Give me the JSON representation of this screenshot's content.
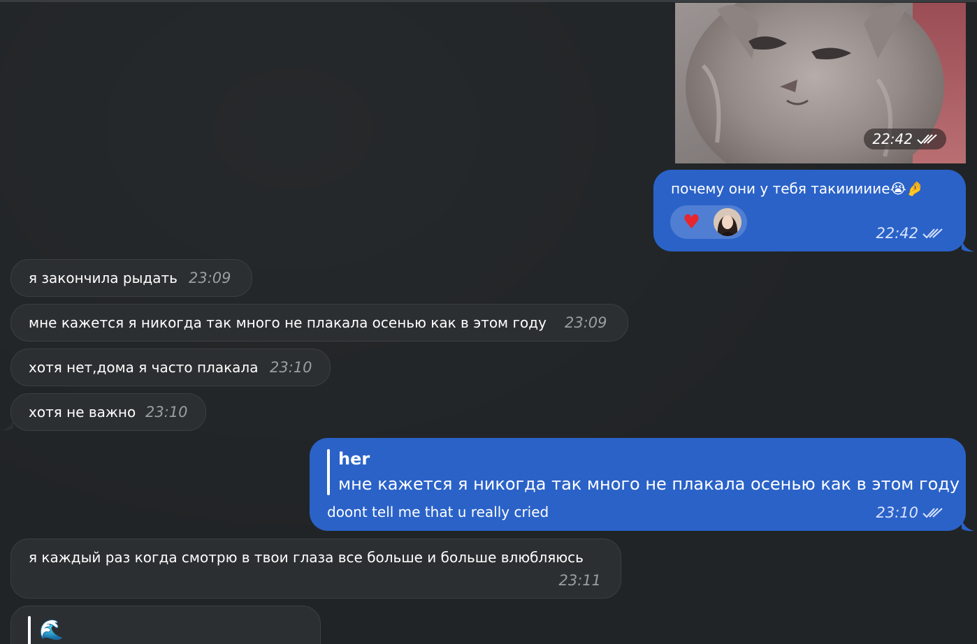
{
  "photo": {
    "time": "22:42"
  },
  "messages": [
    {
      "id": "m1",
      "text": "почему они у тебя такиииииe",
      "time": "22:42",
      "emoji": "😭🤌",
      "reaction": "❤️"
    },
    {
      "id": "m2",
      "text": "я закончила рыдать",
      "time": "23:09"
    },
    {
      "id": "m3",
      "text": "мне кажется я никогда так много не плакала осенью как в этом году",
      "time": "23:09"
    },
    {
      "id": "m4",
      "text": "хотя нет,дома я часто плакала",
      "time": "23:10"
    },
    {
      "id": "m5",
      "text": "хотя не важно",
      "time": "23:10"
    },
    {
      "id": "m6",
      "reply_name": "her",
      "reply_text": "мне кажется я никогда так много не плакала осенью как в этом году",
      "text": "doont tell me that u really cried",
      "time": "23:10"
    },
    {
      "id": "m7",
      "text": "я каждый раз когда смотрю в твои глаза все больше и больше влюбляюсь",
      "time": "23:11"
    },
    {
      "id": "m8",
      "reply_emoji": "🌊"
    }
  ],
  "colors": {
    "background": "#212426",
    "incoming": "#2c2f31",
    "outgoing": "#2a62c8",
    "reaction_heart": "#e8262d"
  }
}
